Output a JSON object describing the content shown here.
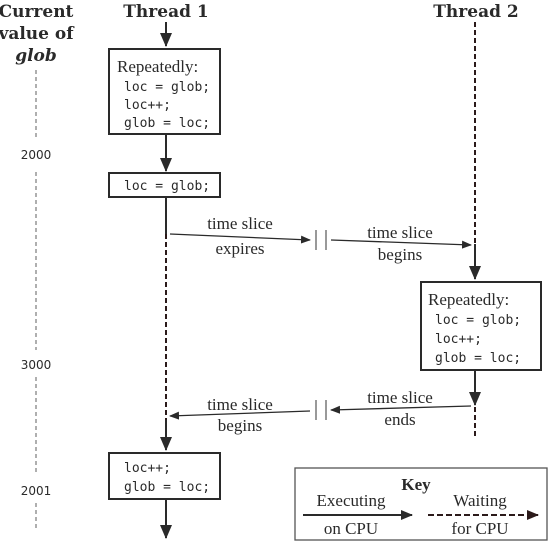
{
  "header": {
    "value_column": [
      "Current",
      "value of",
      "glob"
    ],
    "thread1": "Thread 1",
    "thread2": "Thread 2"
  },
  "glob_values": [
    "2000",
    "3000",
    "2001"
  ],
  "thread1": {
    "box1": {
      "title": "Repeatedly:",
      "lines": [
        "loc = glob;",
        "loc++;",
        "glob = loc;"
      ]
    },
    "box2": {
      "lines": [
        "loc = glob;"
      ]
    },
    "box3": {
      "lines": [
        "loc++;",
        "glob = loc;"
      ]
    }
  },
  "thread2": {
    "box1": {
      "title": "Repeatedly:",
      "lines": [
        "loc = glob;",
        "loc++;",
        "glob = loc;"
      ]
    }
  },
  "transitions": {
    "first": {
      "left": {
        "top": "time slice",
        "bottom": "expires"
      },
      "right": {
        "top": "time slice",
        "bottom": "begins"
      }
    },
    "second": {
      "left": {
        "top": "time slice",
        "bottom": "begins"
      },
      "right": {
        "top": "time slice",
        "bottom": "ends"
      }
    }
  },
  "key": {
    "title": "Key",
    "executing": {
      "top": "Executing",
      "bottom": "on CPU"
    },
    "waiting": {
      "top": "Waiting",
      "bottom": "for CPU"
    }
  },
  "colors": {
    "ink": "#2a2a2a",
    "waiting_line": "#2b1a1a",
    "value_axis": "#7a7a7a"
  }
}
